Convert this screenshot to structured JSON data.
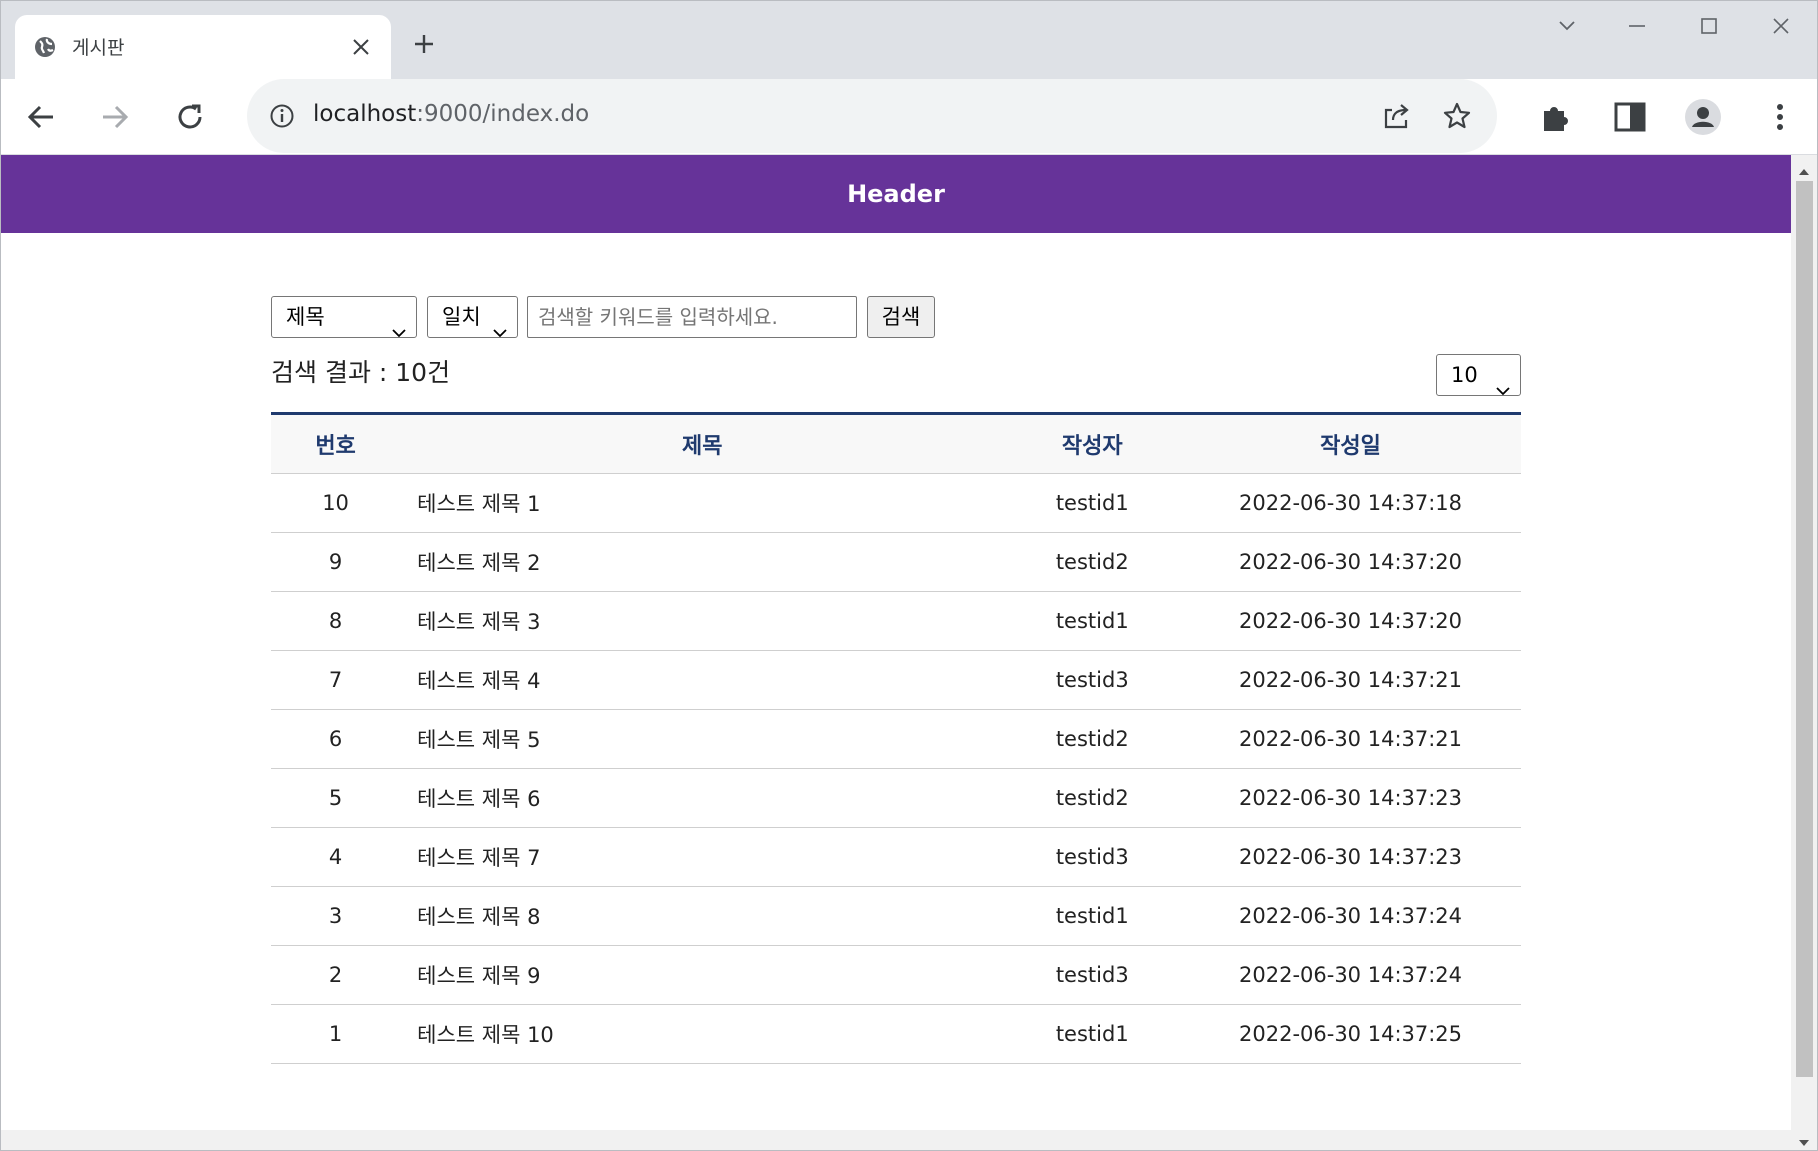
{
  "browser": {
    "tab_title": "게시판",
    "url_host": "localhost",
    "url_rest": ":9000/index.do"
  },
  "page": {
    "header_title": "Header",
    "search": {
      "field_selected": "제목",
      "match_selected": "일치",
      "placeholder": "검색할 키워드를 입력하세요.",
      "button_label": "검색"
    },
    "result_text": "검색 결과 : 10건",
    "page_size_selected": "10",
    "table": {
      "headers": [
        "번호",
        "제목",
        "작성자",
        "작성일"
      ],
      "rows": [
        {
          "num": "10",
          "title": "테스트 제목 1",
          "writer": "testid1",
          "date": "2022-06-30 14:37:18"
        },
        {
          "num": "9",
          "title": "테스트 제목 2",
          "writer": "testid2",
          "date": "2022-06-30 14:37:20"
        },
        {
          "num": "8",
          "title": "테스트 제목 3",
          "writer": "testid1",
          "date": "2022-06-30 14:37:20"
        },
        {
          "num": "7",
          "title": "테스트 제목 4",
          "writer": "testid3",
          "date": "2022-06-30 14:37:21"
        },
        {
          "num": "6",
          "title": "테스트 제목 5",
          "writer": "testid2",
          "date": "2022-06-30 14:37:21"
        },
        {
          "num": "5",
          "title": "테스트 제목 6",
          "writer": "testid2",
          "date": "2022-06-30 14:37:23"
        },
        {
          "num": "4",
          "title": "테스트 제목 7",
          "writer": "testid3",
          "date": "2022-06-30 14:37:23"
        },
        {
          "num": "3",
          "title": "테스트 제목 8",
          "writer": "testid1",
          "date": "2022-06-30 14:37:24"
        },
        {
          "num": "2",
          "title": "테스트 제목 9",
          "writer": "testid3",
          "date": "2022-06-30 14:37:24"
        },
        {
          "num": "1",
          "title": "테스트 제목 10",
          "writer": "testid1",
          "date": "2022-06-30 14:37:25"
        }
      ]
    }
  },
  "colors": {
    "header_bg": "#663399",
    "table_header_text": "#1f3a6e"
  },
  "icons": [
    "globe-icon",
    "close-icon",
    "plus-icon",
    "chevron-down-icon",
    "minimize-icon",
    "maximize-icon",
    "back-arrow-icon",
    "forward-arrow-icon",
    "reload-icon",
    "info-icon",
    "share-icon",
    "star-icon",
    "puzzle-icon",
    "side-panel-icon",
    "profile-icon",
    "menu-dots-icon"
  ]
}
